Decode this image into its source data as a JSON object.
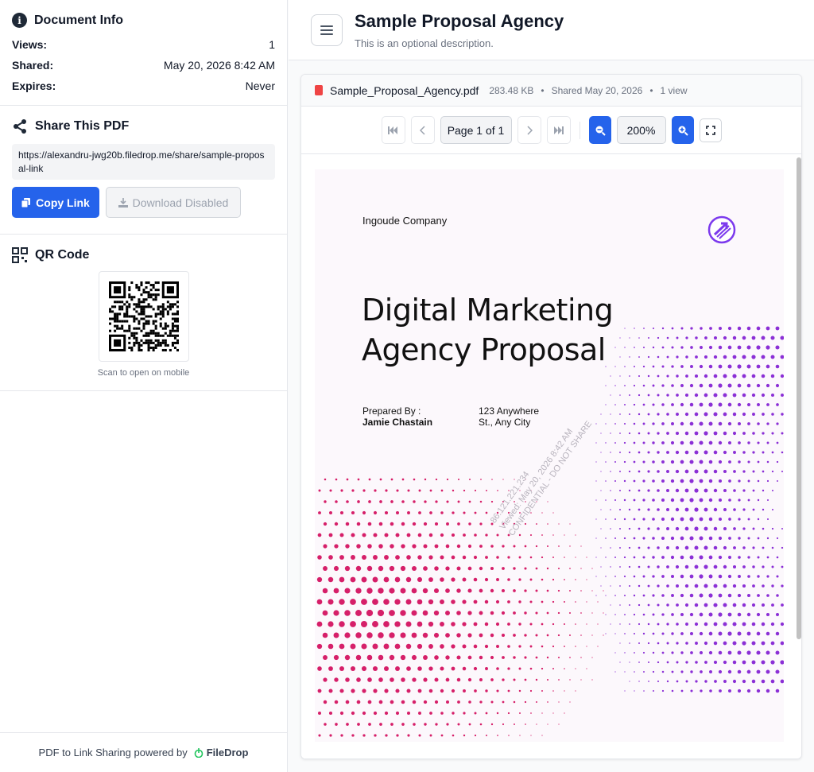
{
  "sidebar": {
    "doc_info": {
      "title": "Document Info",
      "rows": [
        {
          "label": "Views:",
          "value": "1"
        },
        {
          "label": "Shared:",
          "value": "May 20, 2026 8:42 AM"
        },
        {
          "label": "Expires:",
          "value": "Never"
        }
      ]
    },
    "share": {
      "title": "Share This PDF",
      "url": "https://alexandru-jwg20b.filedrop.me/share/sample-proposal-link",
      "copy_label": "Copy Link",
      "download_label": "Download Disabled"
    },
    "qr": {
      "title": "QR Code",
      "caption": "Scan to open on mobile"
    },
    "footer": {
      "text": "PDF to Link Sharing powered by",
      "brand": "FileDrop"
    }
  },
  "header": {
    "title": "Sample Proposal Agency",
    "description": "This is an optional description."
  },
  "file": {
    "name": "Sample_Proposal_Agency.pdf",
    "size": "283.48 KB",
    "shared": "Shared May 20, 2026",
    "views": "1 view"
  },
  "toolbar": {
    "page_label": "Page 1 of 1",
    "zoom_label": "200%"
  },
  "document": {
    "company": "Ingoude Company",
    "title_line1": "Digital Marketing",
    "title_line2": "Agency Proposal",
    "prepared_label": "Prepared By :",
    "prepared_name": "Jamie Chastain",
    "address_line1": "123 Anywhere",
    "address_line2": "St., Any City",
    "watermark_line1": "86.121.221.234",
    "watermark_line2": "Viewed: May 20, 2026 8:42 AM",
    "watermark_line3": "CONFIDENTIAL - DO NOT SHARE"
  },
  "colors": {
    "accent": "#2563eb",
    "pdf_icon": "#ef4444",
    "dot_pink": "#d61f69",
    "dot_purple": "#8b2fd6"
  }
}
